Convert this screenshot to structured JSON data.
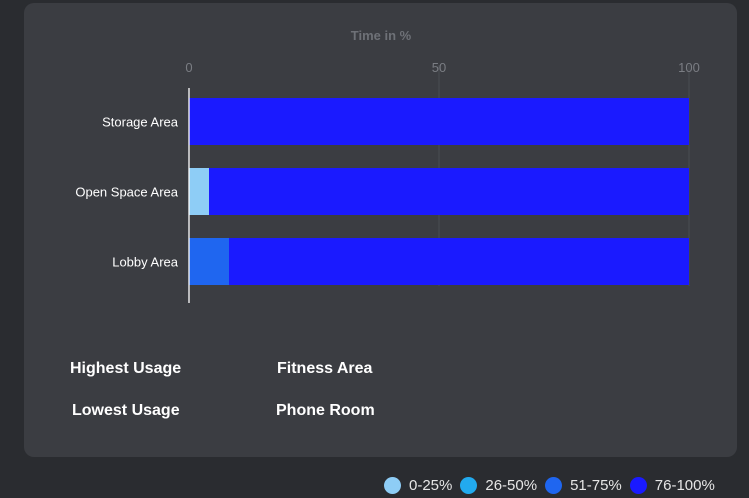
{
  "chart_data": {
    "type": "bar",
    "stacked": true,
    "orientation": "horizontal",
    "title": "Time in %",
    "categories": [
      "Storage Area",
      "Open Space Area",
      "Lobby Area"
    ],
    "xlim": [
      0,
      100
    ],
    "xticks": [
      "0",
      "50",
      "100"
    ],
    "series": [
      {
        "name": "0-25%",
        "color": "#8ecdf6",
        "values": [
          0,
          4,
          0
        ]
      },
      {
        "name": "26-50%",
        "color": "#22aaee",
        "values": [
          0,
          0,
          0
        ]
      },
      {
        "name": "51-75%",
        "color": "#1f66f0",
        "values": [
          0,
          0,
          8
        ]
      },
      {
        "name": "76-100%",
        "color": "#1a1aff",
        "values": [
          100,
          96,
          92
        ]
      }
    ],
    "grid": true,
    "legend_position": "bottom-right"
  },
  "summary": {
    "highest_label": "Highest Usage",
    "highest_value": "Fitness Area",
    "lowest_label": "Lowest Usage",
    "lowest_value": "Phone Room"
  },
  "legend": [
    {
      "label": "0-25%",
      "color": "#8ecdf6"
    },
    {
      "label": "26-50%",
      "color": "#22aaee"
    },
    {
      "label": "51-75%",
      "color": "#1f66f0"
    },
    {
      "label": "76-100%",
      "color": "#1a1aff"
    }
  ]
}
